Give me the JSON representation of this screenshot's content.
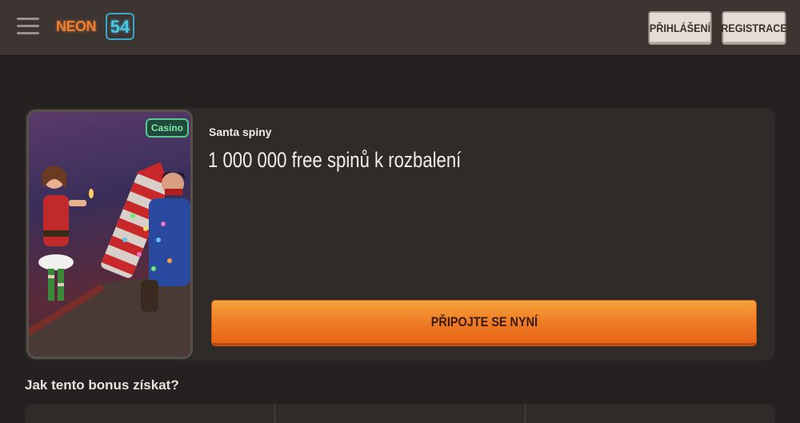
{
  "header": {
    "logo": {
      "text": "NEON",
      "number": "54"
    },
    "login_label": "PŘIHLÁŠENÍ",
    "register_label": "REGISTRACE"
  },
  "bonus": {
    "badge": "Casino",
    "subtitle": "Santa spiny",
    "title": "1 000 000 free spinů k rozbalení",
    "cta_label": "PŘIPOJTE SE NYNÍ"
  },
  "how_to": {
    "heading": "Jak tento bonus získat?"
  },
  "colors": {
    "header_bg": "#3c3532",
    "page_bg": "#242120",
    "card_bg": "#2f2b29",
    "cta_orange": "#ee7a24",
    "badge_green": "#5ac890"
  }
}
